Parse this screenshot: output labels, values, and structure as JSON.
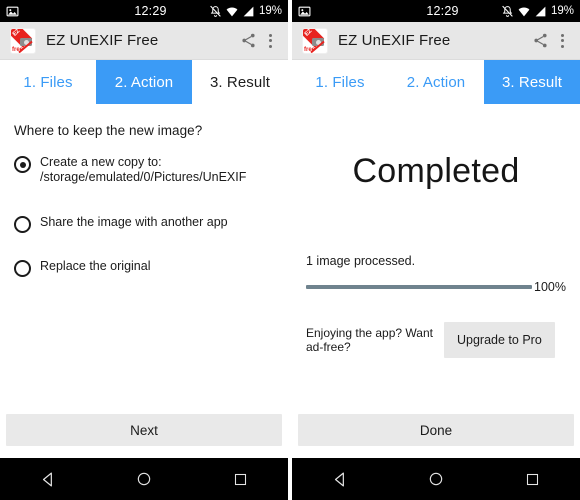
{
  "status_bar": {
    "time": "12:29",
    "battery": "19%",
    "icons": [
      "photo-icon",
      "silent-bell-icon",
      "wifi-icon",
      "signal-icon"
    ]
  },
  "action_bar": {
    "app_title": "EZ UnEXIF Free",
    "icon_banner_text": "EZ",
    "icon_free_text": "free",
    "share_label": "share-icon",
    "overflow_label": "overflow-menu-icon"
  },
  "screen_left": {
    "tabs": [
      {
        "label": "1. Files",
        "state": "link"
      },
      {
        "label": "2. Action",
        "state": "active"
      },
      {
        "label": "3. Result",
        "state": "dark"
      }
    ],
    "question": "Where to keep the new image?",
    "options": [
      {
        "label": "Create a new copy to: /storage/emulated/0/Pictures/UnEXIF",
        "checked": true
      },
      {
        "label": "Share the image with another app",
        "checked": false
      },
      {
        "label": "Replace the original",
        "checked": false
      }
    ],
    "primary_button": "Next"
  },
  "screen_right": {
    "tabs": [
      {
        "label": "1. Files",
        "state": "link"
      },
      {
        "label": "2. Action",
        "state": "link"
      },
      {
        "label": "3. Result",
        "state": "active"
      }
    ],
    "headline": "Completed",
    "processed_text": "1 image processed.",
    "progress_percent": "100%",
    "progress_value": 100,
    "promo_text": "Enjoying the app? Want ad-free?",
    "upgrade_button": "Upgrade to Pro",
    "primary_button": "Done"
  },
  "nav_bar": {
    "back": "back-triangle-icon",
    "home": "home-circle-icon",
    "recents": "recents-square-icon"
  },
  "colors": {
    "accent_blue": "#3b9bf6",
    "brand_red": "#e8231f",
    "progress": "#6f838e",
    "action_bar_bg": "#e7e7e7",
    "button_bg": "#e9e9e9"
  }
}
